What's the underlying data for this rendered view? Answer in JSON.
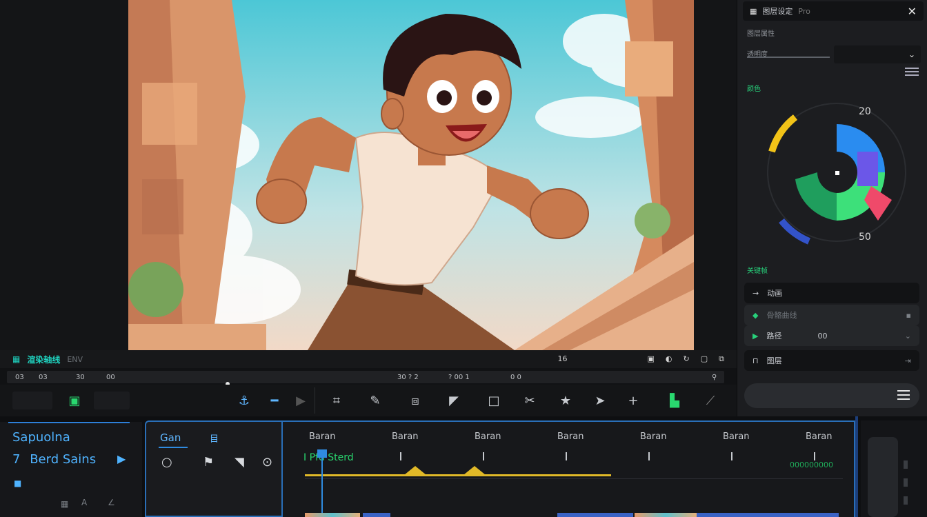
{
  "strip": {
    "title": "渲染轴线",
    "sub": "ENV",
    "right_items": [
      "16",
      "▣",
      "◐",
      "↻",
      "▢",
      "⧉"
    ]
  },
  "ruler": {
    "labels": [
      "03",
      "03",
      "30",
      "00",
      "30 ? 2",
      "? 00 1",
      "0 0"
    ]
  },
  "inspector": {
    "header_title": "图层设定",
    "header_sub": "Pro",
    "section1": "图层属性",
    "section2": "透明度",
    "section3": "颜色",
    "wheel_top": "20",
    "wheel_bottom": "50",
    "section4": "关键帧",
    "rows": [
      {
        "label": "动画",
        "trail": ""
      },
      {
        "label": "骨骼曲线",
        "trail": ""
      },
      {
        "label": "路径",
        "trail": "00"
      },
      {
        "label": "图层",
        "trail": ""
      }
    ]
  },
  "left_panel": {
    "title": "Sapuolna",
    "item": "Berd Sains",
    "item_prefix": "7"
  },
  "gen_panel": {
    "tab1": "Gan",
    "tab2": "目"
  },
  "timeline": {
    "labels": [
      "Baran",
      "Baran",
      "Baran",
      "Baran",
      "Baran",
      "Baran",
      "Baran"
    ],
    "clip_label": "I Pfd Sterd",
    "right_green": "000000000"
  },
  "colors": {
    "accent_blue": "#2f8be0",
    "accent_green": "#29d86f",
    "key_yellow": "#e1b928"
  }
}
